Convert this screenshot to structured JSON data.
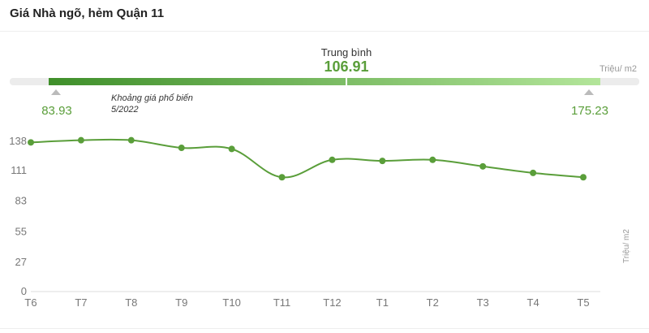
{
  "header": {
    "title": "Giá Nhà ngõ, hẻm Quận 11"
  },
  "range_bar": {
    "average_label": "Trung bình",
    "average_value": "106.91",
    "min_value": "83.93",
    "max_value": "175.23",
    "unit": "Triệu/ m2",
    "note_line1": "Khoảng giá phổ biến",
    "note_line2": "5/2022",
    "colors": {
      "dark": "#3f8f2a",
      "light": "#b3e59a",
      "track": "#ececec",
      "line": "#5a9e3a"
    }
  },
  "chart_data": {
    "type": "line",
    "categories": [
      "T6",
      "T7",
      "T8",
      "T9",
      "T10",
      "T11",
      "T12",
      "T1",
      "T2",
      "T3",
      "T4",
      "T5"
    ],
    "series": [
      {
        "values": [
          137,
          139,
          139,
          132,
          131,
          105,
          121,
          120,
          121,
          115,
          109,
          105
        ]
      }
    ],
    "yticks": [
      "0",
      "27",
      "55",
      "83",
      "111",
      "138"
    ],
    "ylim": [
      0,
      138
    ],
    "ylabel": "Triệu/ m2",
    "grid": false
  }
}
